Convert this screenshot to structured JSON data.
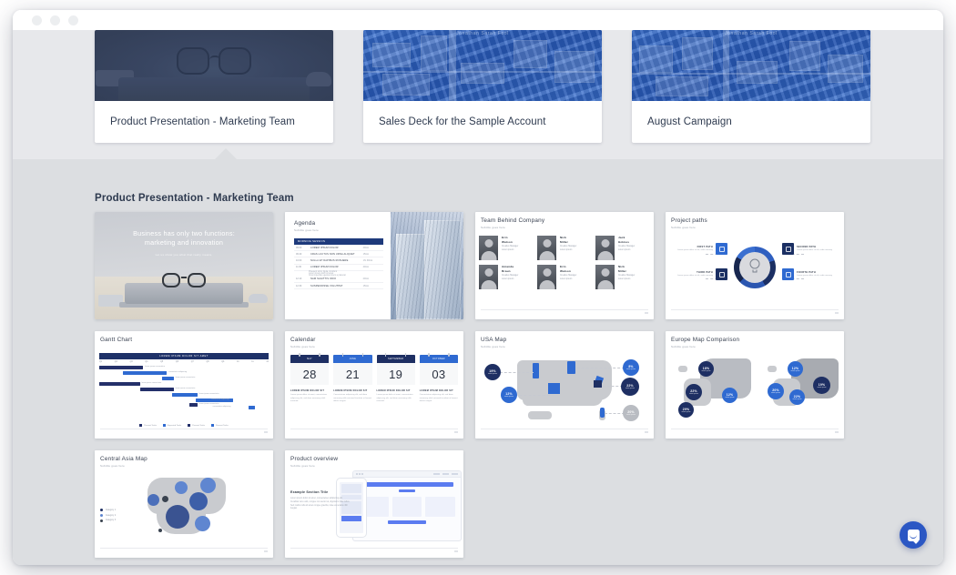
{
  "window": {
    "traffic_dots": 3
  },
  "decks": [
    {
      "title": "Product Presentation - Marketing Team",
      "thumb": "navy-desk-glasses",
      "watermark": ""
    },
    {
      "title": "Sales Deck for the Sample Account",
      "thumb": "blue-city-aerial",
      "watermark": "Jonathan Sarah Fool"
    },
    {
      "title": "August Campaign",
      "thumb": "blue-city-aerial",
      "watermark": "Jonathan Sarah Fool"
    }
  ],
  "panel": {
    "heading": "Product Presentation - Marketing Team"
  },
  "slides": [
    {
      "id": "title-slide",
      "kind": "hero",
      "headline_line1": "Business has only two functions:",
      "headline_line2": "marketing and innovation",
      "subtitle": "Let us show you what that really means."
    },
    {
      "id": "agenda",
      "kind": "agenda",
      "title": "Agenda",
      "subtitle": "Subtitle goes here",
      "header_bar": "MORNING SESSION",
      "rows": [
        {
          "time": "09:00",
          "name": "LOREM IPSUM DOLOR",
          "who": "40min"
        },
        {
          "time": "09:40",
          "name": "CRAS LUCTUS NON URNA ALIQUET",
          "who": "15min"
        },
        {
          "time": "10:00",
          "name": "NULLA ET DAPIBUS ROSUERE",
          "who": "1hr 30min"
        },
        {
          "time": "11:30",
          "name": "LOREM IPSUM DOLOR",
          "who": "40min"
        }
      ],
      "sub_rows": [
        "Praesent tortor ligula, tincidunt",
        "Lorem lorem dolor sit amet",
        "Cras imperdiet egestas lorem a placerat"
      ],
      "rows_tail": [
        {
          "time": "12:10",
          "name": "NAM SAGITTIS ODIO",
          "who": "20min"
        },
        {
          "time": "12:30",
          "name": "SUSPENDISSE VOLUTPAT",
          "who": "15min"
        }
      ]
    },
    {
      "id": "team",
      "kind": "team",
      "title": "Team Behind Company",
      "subtitle": "Subtitle goes here",
      "members": [
        {
          "name": "Erin\nWatson",
          "role": "Creative Manager\nLorem ipsum"
        },
        {
          "name": "Nick\nMiller",
          "role": "Creative Manager\nLorem ipsum"
        },
        {
          "name": "Jack\nHolmes",
          "role": "Creative Manager\nLorem ipsum"
        },
        {
          "name": "Amanda\nBraun",
          "role": "Creative Manager\nLorem ipsum"
        },
        {
          "name": "Erin\nWatson",
          "role": "Creative Manager\nLorem ipsum"
        },
        {
          "name": "Nick\nMiller",
          "role": "Creative Manager\nLorem ipsum"
        }
      ]
    },
    {
      "id": "project-paths",
      "kind": "paths",
      "title": "Project paths",
      "subtitle": "Subtitle goes here",
      "center_icon": "lightbulb-icon",
      "items": [
        {
          "label": "FIRST PATH",
          "body": "Lorem ipsum dolor sit elit, sadis nonumy",
          "icon": "monitor-icon",
          "tone": "light"
        },
        {
          "label": "SECOND PATH",
          "body": "Lorem ipsum dolor sit elit, sadis nonumy",
          "icon": "rocket-icon",
          "tone": "dark"
        },
        {
          "label": "THIRD PATH",
          "body": "Lorem ipsum dolor sit elit, sadis nonumy",
          "icon": "target-icon",
          "tone": "dark"
        },
        {
          "label": "FOURTH PATH",
          "body": "Lorem ipsum dolor sit elit, sadis nonumy",
          "icon": "percent-icon",
          "tone": "light"
        }
      ]
    },
    {
      "id": "gantt",
      "kind": "gantt",
      "title": "Gantt Chart",
      "header_bar": "LOREM IPSUM DOLOR SIT AMET",
      "axis": [
        "Q1",
        "Q2",
        "Q3",
        "Q4",
        "Q5",
        "Q6",
        "Q7",
        "Q8",
        "Q9",
        "10",
        "11",
        "12"
      ],
      "legend": [
        "Present Tasks",
        "Expected Tasks",
        "Present Tasks",
        "Present Tasks"
      ]
    },
    {
      "id": "calendar",
      "kind": "calendar",
      "title": "Calendar",
      "subtitle": "Subtitle goes here",
      "cards": [
        {
          "month": "MAY",
          "day": "28",
          "heading": "LOREM IPSUM DOLOR SIT",
          "body": "Lorem ipsum dolor sit amet, consectetuer adipiscing elit, sed diam nonummy nibh euismod."
        },
        {
          "month": "JUNE",
          "day": "21",
          "heading": "LOREM IPSUM DOLOR SIT",
          "body": "Consectetuer adipiscing elit, sed diam nonummy nibh euismod tincidunt ut laoreet dolore magna."
        },
        {
          "month": "SEPTEMBER",
          "day": "19",
          "heading": "LOREM IPSUM DOLOR SIT",
          "body": "Lorem ipsum dolor sit amet, consectetuer adipiscing elit, sed diam nonummy nibh euismod."
        },
        {
          "month": "OCTOBER",
          "day": "03",
          "heading": "LOREM IPSUM DOLOR SIT",
          "body": "Consectetuer adipiscing elit, sed diam nonummy nibh euismod tincidunt ut laoreet dolore magna."
        }
      ]
    },
    {
      "id": "usa-map",
      "kind": "usa-map",
      "title": "USA Map",
      "subtitle": "Subtitle goes here",
      "bubbles": [
        {
          "value": "19%",
          "caption": "lorem ipsum",
          "tone": "navy"
        },
        {
          "value": "12%",
          "caption": "lorem ipsum",
          "tone": "blue"
        },
        {
          "value": "8%",
          "caption": "lorem ipsum",
          "tone": "blue"
        },
        {
          "value": "22%",
          "caption": "lorem ipsum",
          "tone": "navy"
        },
        {
          "value": "20%",
          "caption": "lorem ipsum",
          "tone": "gray"
        }
      ]
    },
    {
      "id": "europe-map",
      "kind": "europe-map",
      "title": "Europe Map Comparison",
      "subtitle": "Subtitle goes here",
      "left_bubbles": [
        {
          "value": "18%",
          "caption": "lorem ipsum",
          "tone": "navy"
        },
        {
          "value": "22%",
          "caption": "lorem ipsum",
          "tone": "navy"
        },
        {
          "value": "12%",
          "caption": "lorem ipsum",
          "tone": "blue"
        },
        {
          "value": "29%",
          "caption": "lorem ipsum",
          "tone": "navy"
        }
      ],
      "right_bubbles": [
        {
          "value": "12%",
          "caption": "lorem ipsum",
          "tone": "blue"
        },
        {
          "value": "20%",
          "caption": "lorem ipsum",
          "tone": "blue"
        },
        {
          "value": "22%",
          "caption": "lorem ipsum",
          "tone": "blue"
        },
        {
          "value": "19%",
          "caption": "lorem ipsum",
          "tone": "navy"
        }
      ]
    },
    {
      "id": "central-asia-map",
      "kind": "asia-map",
      "title": "Central Asia Map",
      "subtitle": "Subtitle goes here",
      "legend": [
        "Category 1",
        "Category 2",
        "Category 3"
      ]
    },
    {
      "id": "product-overview",
      "kind": "product",
      "title": "Product overview",
      "subtitle": "Subtitle goes here",
      "section_heading": "Example Section Title",
      "section_body": "Lorem ipsum dolor sit amet, consectetuer adipiscing elit. Curabitur arcu velit, congue non auctor at, dignissim vitae tellus. Sed mattis nulla sit amet congue gravida, vitae venenatis nibh feugiat."
    }
  ],
  "chat": {
    "icon": "chat-bubble-icon"
  },
  "colors": {
    "navy": "#1e2f63",
    "blue": "#2f6ad1",
    "panel_bg": "#dcdee1",
    "strip_bg": "#e7e8eb",
    "text": "#2e3a4f"
  }
}
